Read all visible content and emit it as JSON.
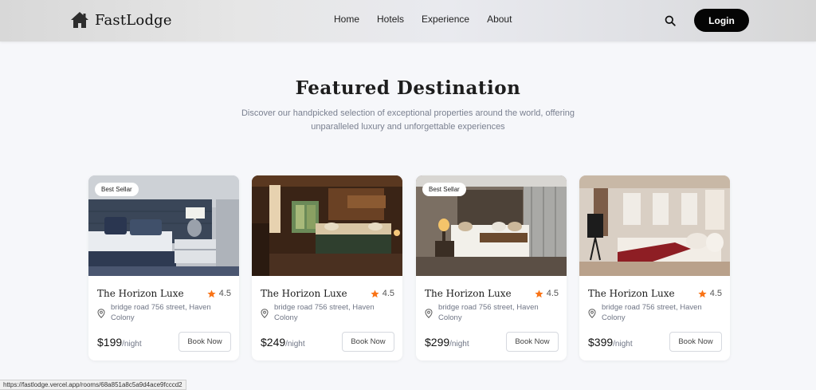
{
  "brand": {
    "name": "FastLodge"
  },
  "nav": {
    "items": [
      "Home",
      "Hotels",
      "Experience",
      "About"
    ]
  },
  "header": {
    "login_label": "Login",
    "search_icon": "search-icon"
  },
  "section": {
    "title": "Featured Destination",
    "subtitle": "Discover our handpicked selection of exceptional properties around the world, offering unparalleled luxury and unforgettable experiences"
  },
  "cards": [
    {
      "badge": "Best Sellar",
      "title": "The Horizon Luxe",
      "rating": "4.5",
      "location": "bridge road 756 street, Haven Colony",
      "price": "$199",
      "unit": "/night",
      "book_label": "Book Now"
    },
    {
      "badge": "",
      "title": "The Horizon Luxe",
      "rating": "4.5",
      "location": "bridge road 756 street, Haven Colony",
      "price": "$249",
      "unit": "/night",
      "book_label": "Book Now"
    },
    {
      "badge": "Best Sellar",
      "title": "The Horizon Luxe",
      "rating": "4.5",
      "location": "bridge road 756 street, Haven Colony",
      "price": "$299",
      "unit": "/night",
      "book_label": "Book Now"
    },
    {
      "badge": "",
      "title": "The Horizon Luxe",
      "rating": "4.5",
      "location": "bridge road 756 street, Haven Colony",
      "price": "$399",
      "unit": "/night",
      "book_label": "Book Now"
    }
  ],
  "status_bar": {
    "url": "https://fastlodge.vercel.app/rooms/68a851a8c5a9d4ace9fcccd2"
  },
  "colors": {
    "accent": "#050505",
    "star": "#f97316",
    "background": "#f6f7fa"
  }
}
